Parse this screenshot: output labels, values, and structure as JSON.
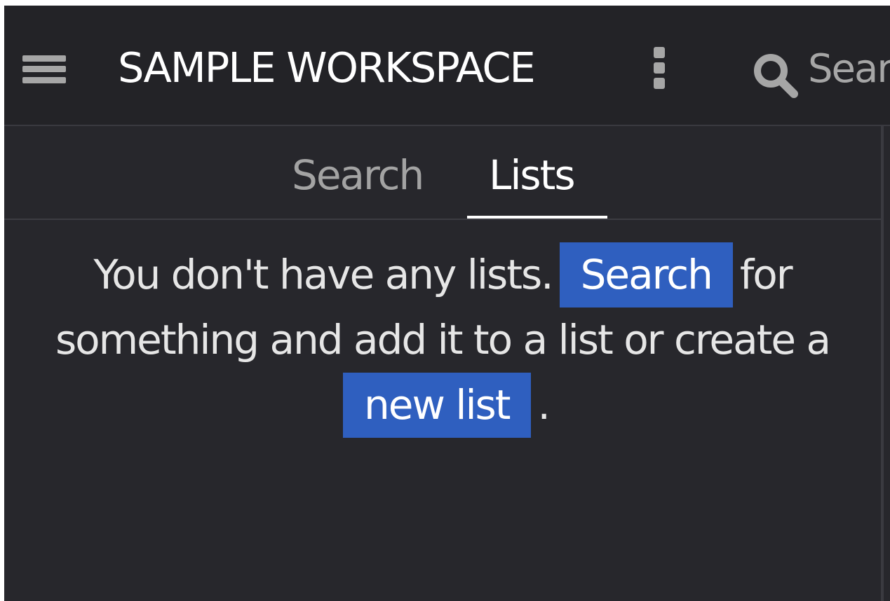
{
  "header": {
    "title": "SAMPLE WORKSPACE",
    "menu_icon": "hamburger-menu-icon",
    "more_icon": "vertical-dots-icon",
    "search_icon": "magnifier-icon",
    "search_value": "",
    "search_placeholder": "Search"
  },
  "tabs": [
    {
      "label": "Search",
      "active": false
    },
    {
      "label": "Lists",
      "active": true
    }
  ],
  "empty_state": {
    "line1_before": "You don't have any lists.",
    "search_link": "Search",
    "line1_after": "for something and add it to a list or create a",
    "new_list_link": "new list",
    "end": "."
  },
  "colors": {
    "background": "#27272c",
    "header_background": "#232327",
    "link_background": "#2f5fbf",
    "text": "#e6e6e6",
    "icon": "#a6a6a6"
  }
}
